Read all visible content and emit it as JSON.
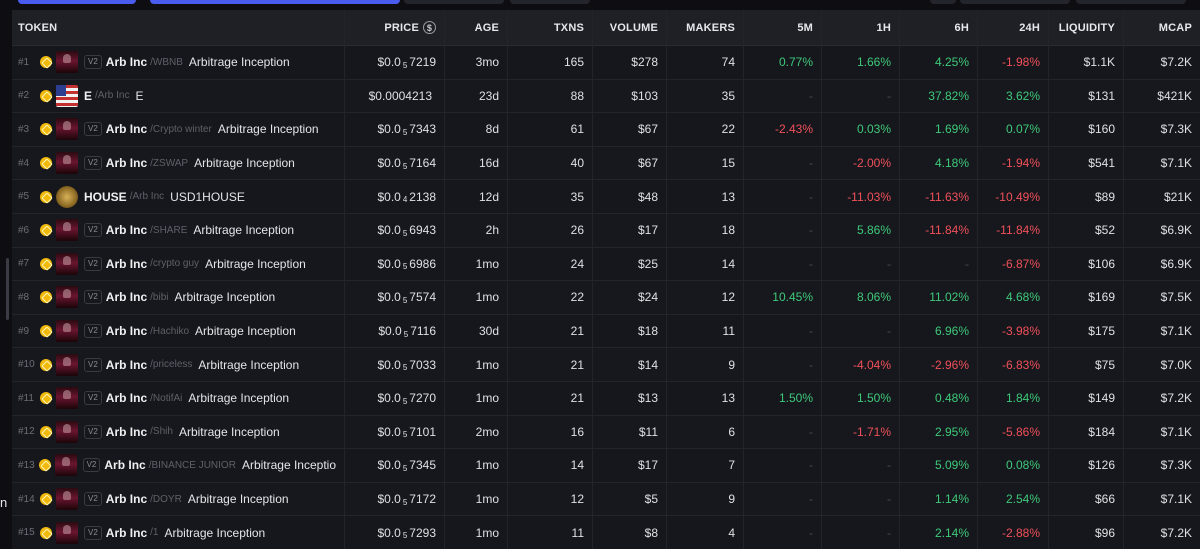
{
  "header": {
    "token": "TOKEN",
    "price": "PRICE",
    "age": "AGE",
    "txns": "TXNS",
    "volume": "VOLUME",
    "makers": "MAKERS",
    "m5": "5M",
    "h1": "1H",
    "h6": "6H",
    "h24": "24H",
    "liquidity": "LIQUIDITY",
    "mcap": "MCAP"
  },
  "edge_letter": "n",
  "colors": {
    "positive": "#3ec97a",
    "negative": "#f0505a",
    "chain": "#f0b90b",
    "accent": "#4a5cf0"
  },
  "rows": [
    {
      "rank": "#1",
      "logo": "arb-logo",
      "v2": "V2",
      "symbol": "Arb Inc",
      "pair": "/WBNB",
      "name": "Arbitrage Inception",
      "price_pre": "$0.0",
      "price_sub": "5",
      "price_post": "7219",
      "age": "3mo",
      "txns": "165",
      "volume": "$278",
      "makers": "74",
      "m5": "0.77%",
      "m5_sign": "pos",
      "h1": "1.66%",
      "h1_sign": "pos",
      "h6": "4.25%",
      "h6_sign": "pos",
      "h24": "-1.98%",
      "h24_sign": "neg",
      "liquidity": "$1.1K",
      "mcap": "$7.2K"
    },
    {
      "rank": "#2",
      "logo": "flag-logo",
      "v2": "",
      "symbol": "E",
      "pair": "/Arb Inc",
      "name": "E",
      "price_pre": "$0.0004213",
      "price_sub": "",
      "price_post": "",
      "age": "23d",
      "txns": "88",
      "volume": "$103",
      "makers": "35",
      "m5": "-",
      "m5_sign": "dash",
      "h1": "-",
      "h1_sign": "dash",
      "h6": "37.82%",
      "h6_sign": "pos",
      "h24": "3.62%",
      "h24_sign": "pos",
      "liquidity": "$131",
      "mcap": "$421K"
    },
    {
      "rank": "#3",
      "logo": "arb-logo",
      "v2": "V2",
      "symbol": "Arb Inc",
      "pair": "/Crypto winter",
      "name": "Arbitrage Inception",
      "price_pre": "$0.0",
      "price_sub": "5",
      "price_post": "7343",
      "age": "8d",
      "txns": "61",
      "volume": "$67",
      "makers": "22",
      "m5": "-2.43%",
      "m5_sign": "neg",
      "h1": "0.03%",
      "h1_sign": "pos",
      "h6": "1.69%",
      "h6_sign": "pos",
      "h24": "0.07%",
      "h24_sign": "pos",
      "liquidity": "$160",
      "mcap": "$7.3K"
    },
    {
      "rank": "#4",
      "logo": "arb-logo",
      "v2": "V2",
      "symbol": "Arb Inc",
      "pair": "/ZSWAP",
      "name": "Arbitrage Inception",
      "price_pre": "$0.0",
      "price_sub": "5",
      "price_post": "7164",
      "age": "16d",
      "txns": "40",
      "volume": "$67",
      "makers": "15",
      "m5": "-",
      "m5_sign": "dash",
      "h1": "-2.00%",
      "h1_sign": "neg",
      "h6": "4.18%",
      "h6_sign": "pos",
      "h24": "-1.94%",
      "h24_sign": "neg",
      "liquidity": "$541",
      "mcap": "$7.1K"
    },
    {
      "rank": "#5",
      "logo": "house-logo",
      "v2": "",
      "symbol": "HOUSE",
      "pair": "/Arb Inc",
      "name": "USD1HOUSE",
      "price_pre": "$0.0",
      "price_sub": "4",
      "price_post": "2138",
      "age": "12d",
      "txns": "35",
      "volume": "$48",
      "makers": "13",
      "m5": "-",
      "m5_sign": "dash",
      "h1": "-11.03%",
      "h1_sign": "neg",
      "h6": "-11.63%",
      "h6_sign": "neg",
      "h24": "-10.49%",
      "h24_sign": "neg",
      "liquidity": "$89",
      "mcap": "$21K"
    },
    {
      "rank": "#6",
      "logo": "arb-logo",
      "v2": "V2",
      "symbol": "Arb Inc",
      "pair": "/SHARE",
      "name": "Arbitrage Inception",
      "price_pre": "$0.0",
      "price_sub": "5",
      "price_post": "6943",
      "age": "2h",
      "txns": "26",
      "volume": "$17",
      "makers": "18",
      "m5": "-",
      "m5_sign": "dash",
      "h1": "5.86%",
      "h1_sign": "pos",
      "h6": "-11.84%",
      "h6_sign": "neg",
      "h24": "-11.84%",
      "h24_sign": "neg",
      "liquidity": "$52",
      "mcap": "$6.9K"
    },
    {
      "rank": "#7",
      "logo": "arb-logo",
      "v2": "V2",
      "symbol": "Arb Inc",
      "pair": "/crypto guy",
      "name": "Arbitrage Inception",
      "price_pre": "$0.0",
      "price_sub": "5",
      "price_post": "6986",
      "age": "1mo",
      "txns": "24",
      "volume": "$25",
      "makers": "14",
      "m5": "-",
      "m5_sign": "dash",
      "h1": "-",
      "h1_sign": "dash",
      "h6": "-",
      "h6_sign": "dash",
      "h24": "-6.87%",
      "h24_sign": "neg",
      "liquidity": "$106",
      "mcap": "$6.9K"
    },
    {
      "rank": "#8",
      "logo": "arb-logo",
      "v2": "V2",
      "symbol": "Arb Inc",
      "pair": "/bibi",
      "name": "Arbitrage Inception",
      "price_pre": "$0.0",
      "price_sub": "5",
      "price_post": "7574",
      "age": "1mo",
      "txns": "22",
      "volume": "$24",
      "makers": "12",
      "m5": "10.45%",
      "m5_sign": "pos",
      "h1": "8.06%",
      "h1_sign": "pos",
      "h6": "11.02%",
      "h6_sign": "pos",
      "h24": "4.68%",
      "h24_sign": "pos",
      "liquidity": "$169",
      "mcap": "$7.5K"
    },
    {
      "rank": "#9",
      "logo": "arb-logo",
      "v2": "V2",
      "symbol": "Arb Inc",
      "pair": "/Hachiko",
      "name": "Arbitrage Inception",
      "price_pre": "$0.0",
      "price_sub": "5",
      "price_post": "7116",
      "age": "30d",
      "txns": "21",
      "volume": "$18",
      "makers": "11",
      "m5": "-",
      "m5_sign": "dash",
      "h1": "-",
      "h1_sign": "dash",
      "h6": "6.96%",
      "h6_sign": "pos",
      "h24": "-3.98%",
      "h24_sign": "neg",
      "liquidity": "$175",
      "mcap": "$7.1K"
    },
    {
      "rank": "#10",
      "logo": "arb-logo",
      "v2": "V2",
      "symbol": "Arb Inc",
      "pair": "/priceless",
      "name": "Arbitrage Inception",
      "price_pre": "$0.0",
      "price_sub": "5",
      "price_post": "7033",
      "age": "1mo",
      "txns": "21",
      "volume": "$14",
      "makers": "9",
      "m5": "-",
      "m5_sign": "dash",
      "h1": "-4.04%",
      "h1_sign": "neg",
      "h6": "-2.96%",
      "h6_sign": "neg",
      "h24": "-6.83%",
      "h24_sign": "neg",
      "liquidity": "$75",
      "mcap": "$7.0K"
    },
    {
      "rank": "#11",
      "logo": "arb-logo",
      "v2": "V2",
      "symbol": "Arb Inc",
      "pair": "/NotifAi",
      "name": "Arbitrage Inception",
      "price_pre": "$0.0",
      "price_sub": "5",
      "price_post": "7270",
      "age": "1mo",
      "txns": "21",
      "volume": "$13",
      "makers": "13",
      "m5": "1.50%",
      "m5_sign": "pos",
      "h1": "1.50%",
      "h1_sign": "pos",
      "h6": "0.48%",
      "h6_sign": "pos",
      "h24": "1.84%",
      "h24_sign": "pos",
      "liquidity": "$149",
      "mcap": "$7.2K"
    },
    {
      "rank": "#12",
      "logo": "arb-logo",
      "v2": "V2",
      "symbol": "Arb Inc",
      "pair": "/Shih",
      "name": "Arbitrage Inception",
      "price_pre": "$0.0",
      "price_sub": "5",
      "price_post": "7101",
      "age": "2mo",
      "txns": "16",
      "volume": "$11",
      "makers": "6",
      "m5": "-",
      "m5_sign": "dash",
      "h1": "-1.71%",
      "h1_sign": "neg",
      "h6": "2.95%",
      "h6_sign": "pos",
      "h24": "-5.86%",
      "h24_sign": "neg",
      "liquidity": "$184",
      "mcap": "$7.1K"
    },
    {
      "rank": "#13",
      "logo": "arb-logo",
      "v2": "V2",
      "symbol": "Arb Inc",
      "pair": "/BINANCE JUNIOR",
      "name": "Arbitrage Inceptio",
      "price_pre": "$0.0",
      "price_sub": "5",
      "price_post": "7345",
      "age": "1mo",
      "txns": "14",
      "volume": "$17",
      "makers": "7",
      "m5": "-",
      "m5_sign": "dash",
      "h1": "-",
      "h1_sign": "dash",
      "h6": "5.09%",
      "h6_sign": "pos",
      "h24": "0.08%",
      "h24_sign": "pos",
      "liquidity": "$126",
      "mcap": "$7.3K"
    },
    {
      "rank": "#14",
      "logo": "arb-logo",
      "v2": "V2",
      "symbol": "Arb Inc",
      "pair": "/DOYR",
      "name": "Arbitrage Inception",
      "price_pre": "$0.0",
      "price_sub": "5",
      "price_post": "7172",
      "age": "1mo",
      "txns": "12",
      "volume": "$5",
      "makers": "9",
      "m5": "-",
      "m5_sign": "dash",
      "h1": "-",
      "h1_sign": "dash",
      "h6": "1.14%",
      "h6_sign": "pos",
      "h24": "2.54%",
      "h24_sign": "pos",
      "liquidity": "$66",
      "mcap": "$7.1K"
    },
    {
      "rank": "#15",
      "logo": "arb-logo",
      "v2": "V2",
      "symbol": "Arb Inc",
      "pair": "/1",
      "name": "Arbitrage Inception",
      "price_pre": "$0.0",
      "price_sub": "5",
      "price_post": "7293",
      "age": "1mo",
      "txns": "11",
      "volume": "$8",
      "makers": "4",
      "m5": "-",
      "m5_sign": "dash",
      "h1": "-",
      "h1_sign": "dash",
      "h6": "2.14%",
      "h6_sign": "pos",
      "h24": "-2.88%",
      "h24_sign": "neg",
      "liquidity": "$96",
      "mcap": "$7.2K"
    }
  ]
}
